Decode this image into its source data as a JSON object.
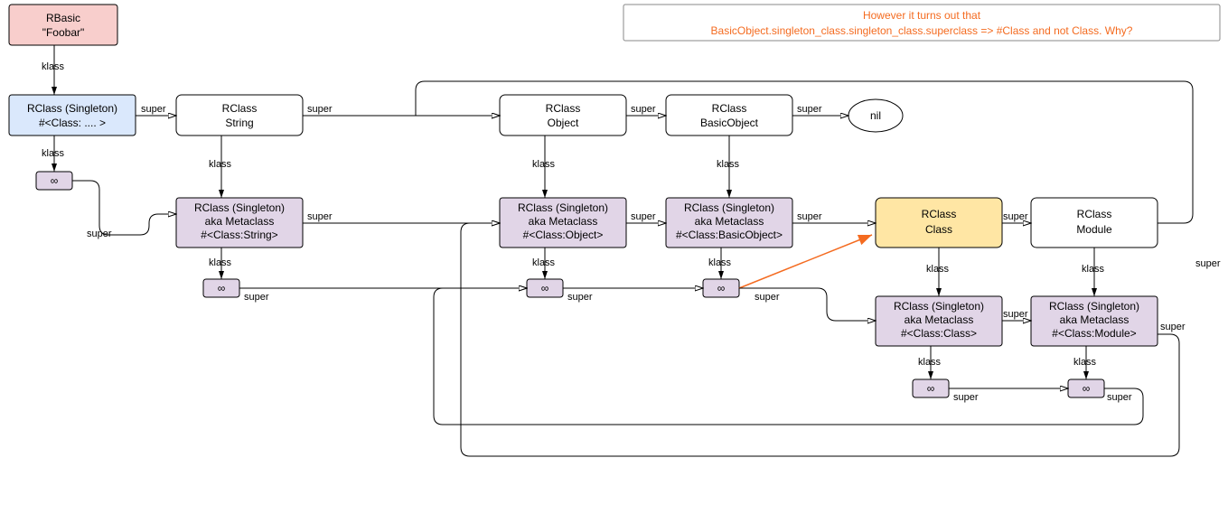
{
  "callout": {
    "line1": "However it turns out that",
    "line2": "BasicObject.singleton_class.singleton_class.superclass  => #Class and not Class. Why?"
  },
  "nodes": {
    "rbasic": {
      "l1": "RBasic",
      "l2": "\"Foobar\""
    },
    "singFoobar": {
      "l1": "RClass (Singleton)",
      "l2": "#<Class: .... >"
    },
    "string": {
      "l1": "RClass",
      "l2": "String"
    },
    "metaString": {
      "l1": "RClass (Singleton)",
      "l2": "aka Metaclass",
      "l3": "#<Class:String>"
    },
    "object": {
      "l1": "RClass",
      "l2": "Object"
    },
    "metaObject": {
      "l1": "RClass (Singleton)",
      "l2": "aka Metaclass",
      "l3": "#<Class:Object>"
    },
    "basicObject": {
      "l1": "RClass",
      "l2": "BasicObject"
    },
    "metaBasic": {
      "l1": "RClass (Singleton)",
      "l2": "aka Metaclass",
      "l3": "#<Class:BasicObject>"
    },
    "klass": {
      "l1": "RClass",
      "l2": "Class"
    },
    "metaKlass": {
      "l1": "RClass (Singleton)",
      "l2": "aka Metaclass",
      "l3": "#<Class:Class>"
    },
    "module": {
      "l1": "RClass",
      "l2": "Module"
    },
    "metaModule": {
      "l1": "RClass (Singleton)",
      "l2": "aka Metaclass",
      "l3": "#<Class:Module>"
    },
    "nil": {
      "l1": "nil"
    }
  },
  "edgeLabels": {
    "klass": "klass",
    "super": "super"
  },
  "inf": "∞"
}
